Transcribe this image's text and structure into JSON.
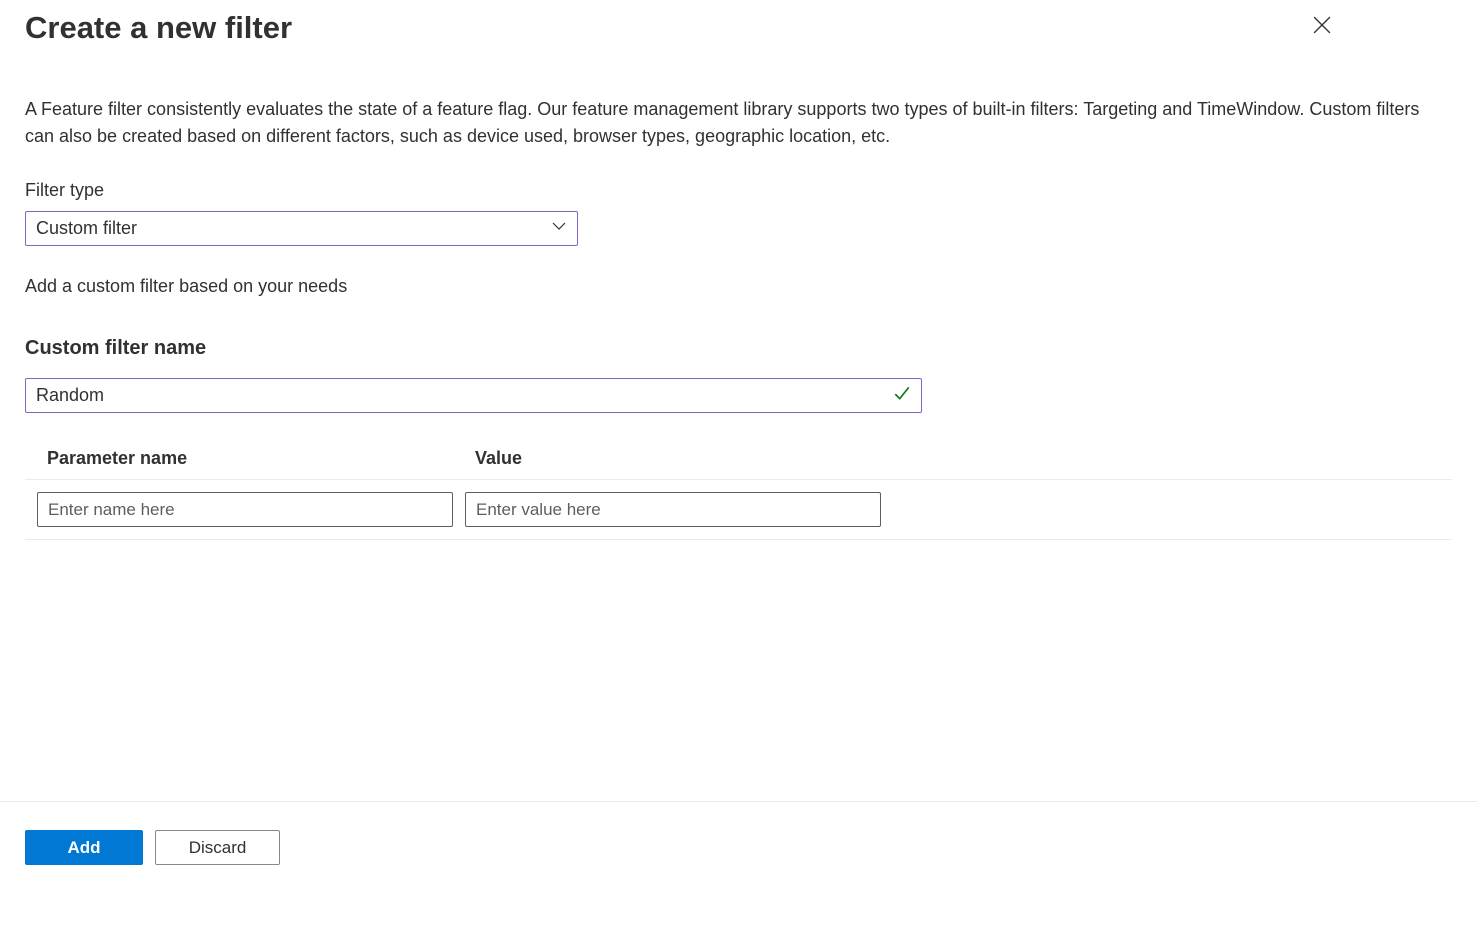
{
  "title": "Create a new filter",
  "description": "A Feature filter consistently evaluates the state of a feature flag. Our feature management library supports two types of built-in filters: Targeting and TimeWindow. Custom filters can also be created based on different factors, such as device used, browser types, geographic location, etc.",
  "filterType": {
    "label": "Filter type",
    "value": "Custom filter"
  },
  "helperText": "Add a custom filter based on your needs",
  "customFilterName": {
    "label": "Custom filter name",
    "value": "Random"
  },
  "paramTable": {
    "headers": {
      "name": "Parameter name",
      "value": "Value"
    },
    "row": {
      "namePlaceholder": "Enter name here",
      "valuePlaceholder": "Enter value here",
      "nameValue": "",
      "valueValue": ""
    }
  },
  "buttons": {
    "add": "Add",
    "discard": "Discard"
  }
}
